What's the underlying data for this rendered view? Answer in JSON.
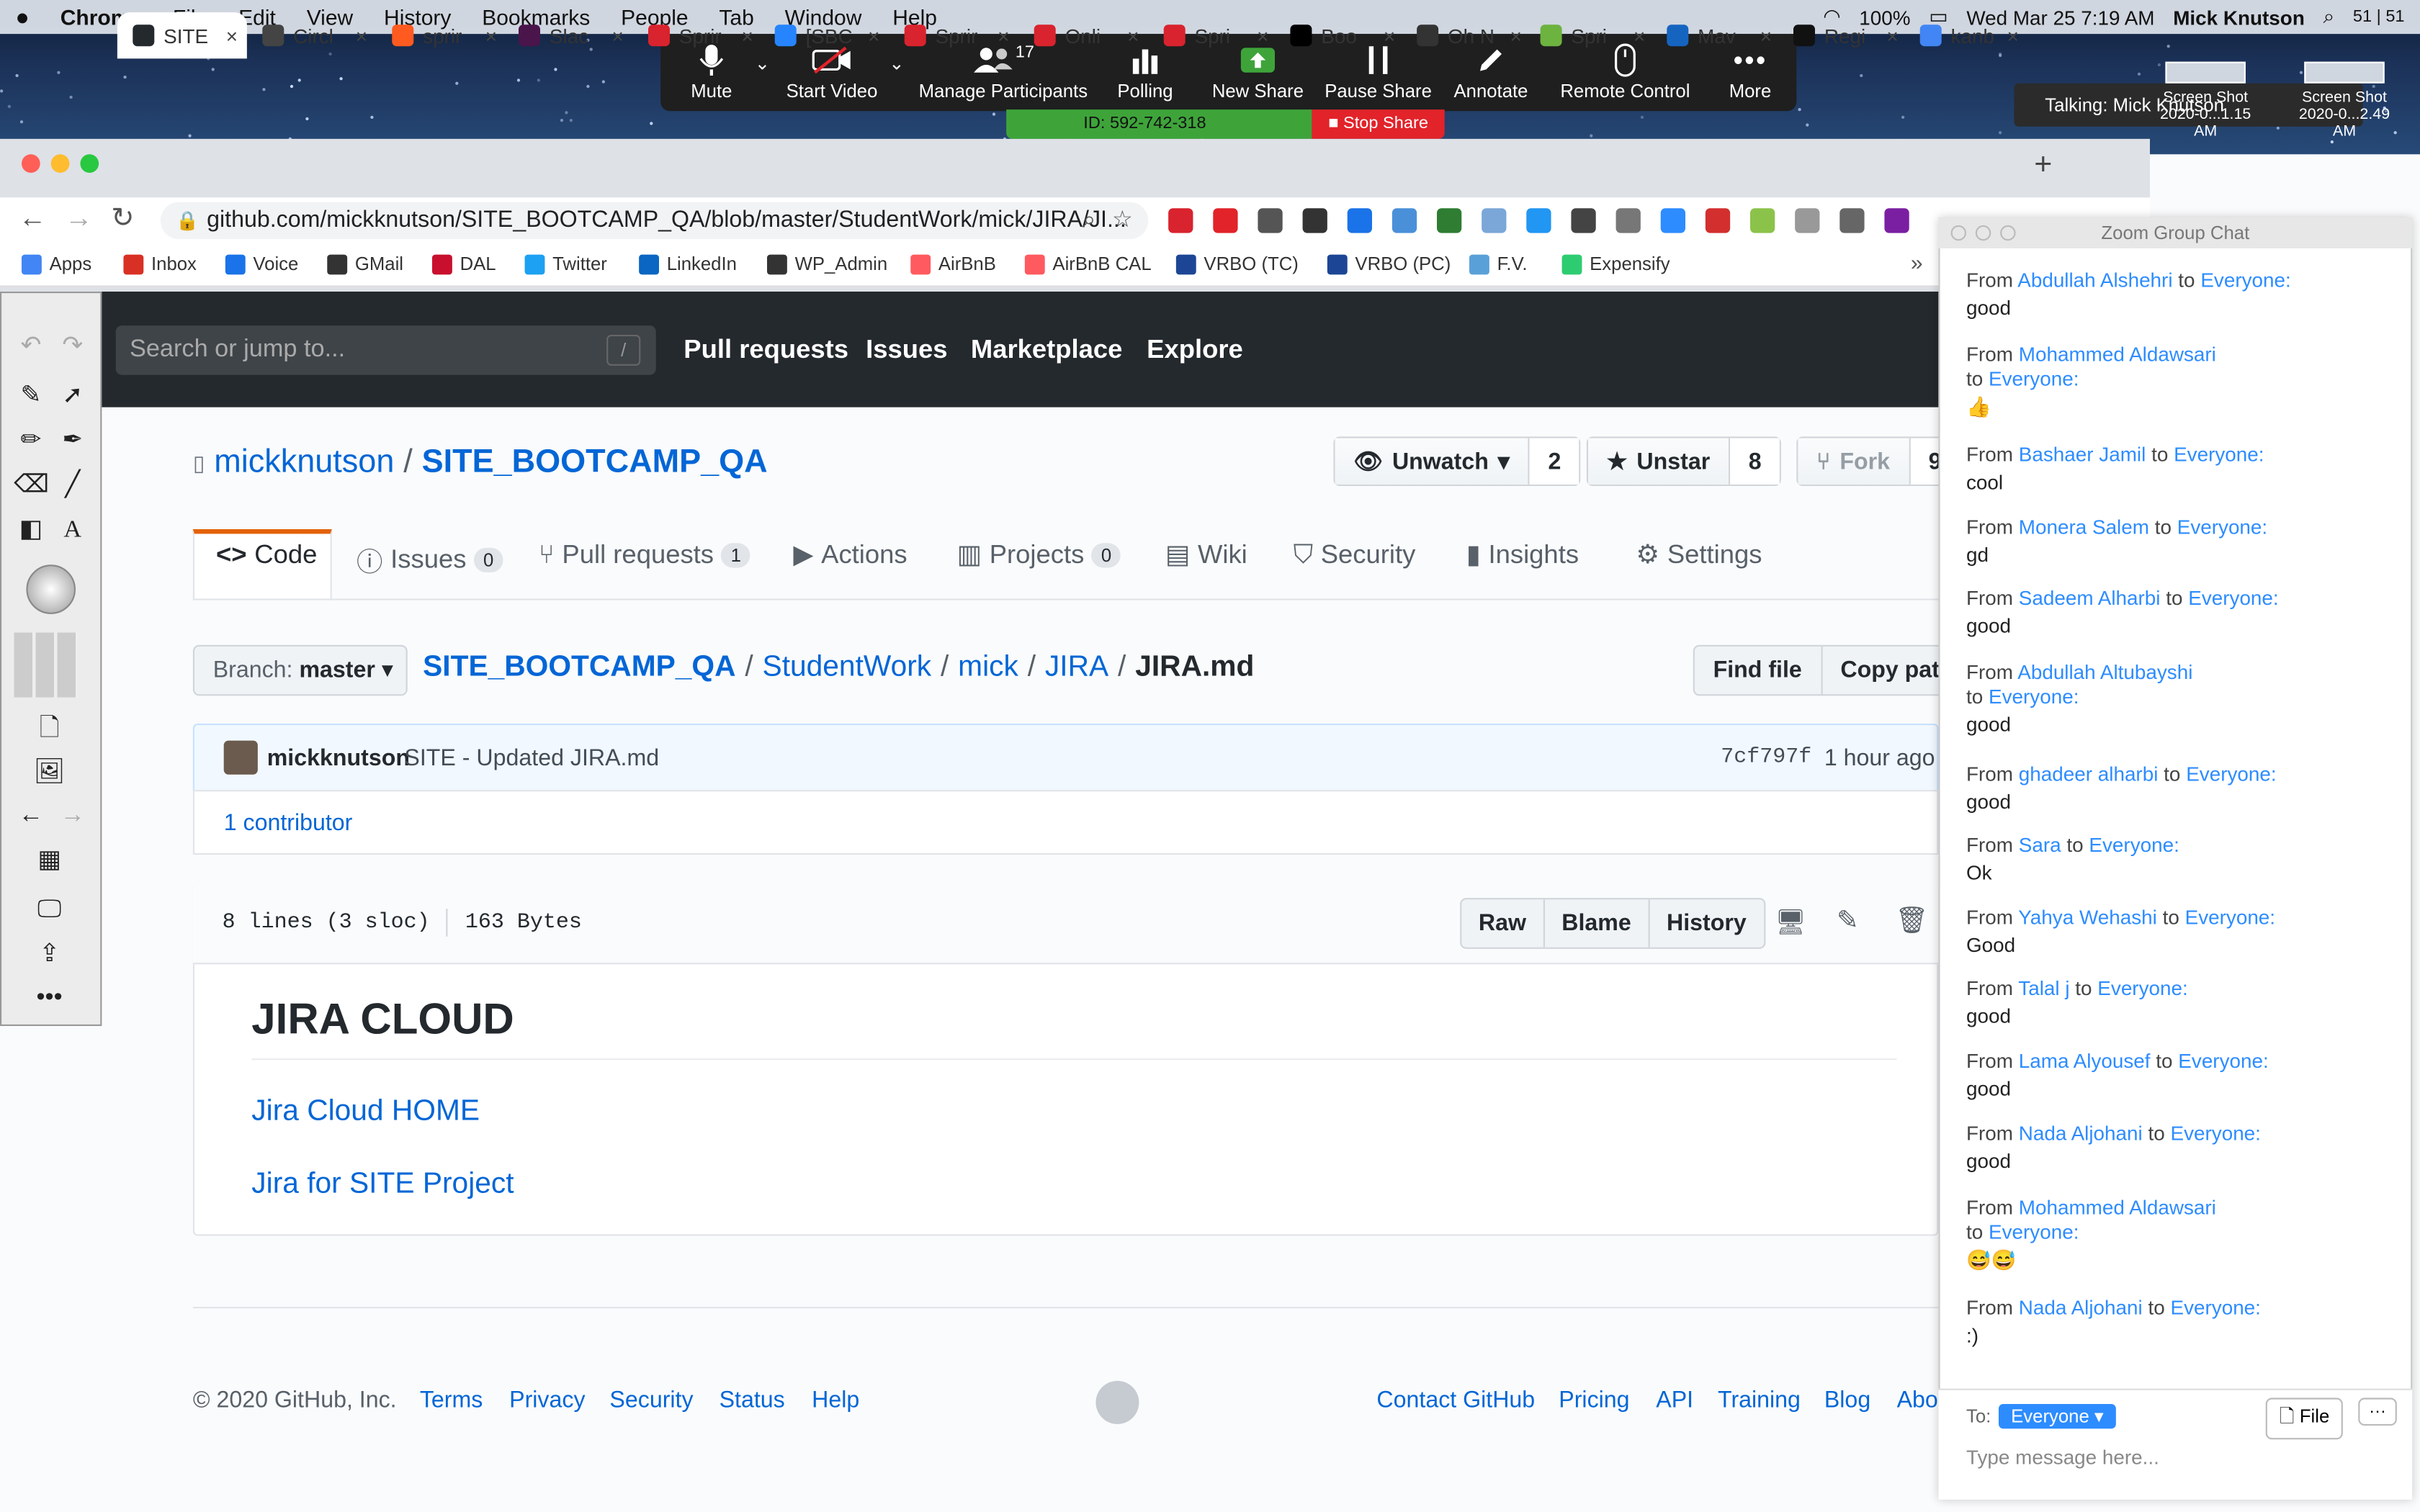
{
  "menubar": {
    "apple_icon": "apple-icon",
    "app": "Chrome",
    "items": [
      "File",
      "Edit",
      "View",
      "History",
      "Bookmarks",
      "People",
      "Tab",
      "Window",
      "Help"
    ],
    "battery": "100%",
    "datetime": "Wed Mar 25  7:19 AM",
    "user": "Mick Knutson",
    "badge": "51 | 51"
  },
  "zoom": {
    "buttons": [
      {
        "label": "Mute",
        "icon": "microphone-icon"
      },
      {
        "label": "Start Video",
        "icon": "video-off-icon"
      },
      {
        "label": "Manage Participants",
        "icon": "participants-icon",
        "count": "17"
      },
      {
        "label": "Polling",
        "icon": "polling-icon"
      },
      {
        "label": "New Share",
        "icon": "share-icon"
      },
      {
        "label": "Pause Share",
        "icon": "pause-icon"
      },
      {
        "label": "Annotate",
        "icon": "pencil-icon"
      },
      {
        "label": "Remote Control",
        "icon": "mouse-icon"
      },
      {
        "label": "More",
        "icon": "more-icon"
      }
    ],
    "meeting_id": "ID: 592-742-318",
    "stop_share": "Stop Share",
    "talking": "Talking: Mick Knutson",
    "screenshots": [
      {
        "line1": "Screen Shot",
        "line2": "2020-0...1.15 AM"
      },
      {
        "line1": "Screen Shot",
        "line2": "2020-0...2.49 AM"
      }
    ]
  },
  "chrome": {
    "tabs": [
      {
        "label": "SITE",
        "color": "#24292e",
        "active": true
      },
      {
        "label": "Circl",
        "color": "#444"
      },
      {
        "label": "sprir",
        "color": "#ff5a1f"
      },
      {
        "label": "Slac",
        "color": "#4a154b"
      },
      {
        "label": "Sprir",
        "color": "#d9232e"
      },
      {
        "label": "[SBC",
        "color": "#2684ff"
      },
      {
        "label": "Sprir",
        "color": "#d9232e"
      },
      {
        "label": "Onli",
        "color": "#d9232e"
      },
      {
        "label": "Spri",
        "color": "#d9232e"
      },
      {
        "label": "Boo",
        "color": "#000"
      },
      {
        "label": "Oh N",
        "color": "#333"
      },
      {
        "label": "Spri",
        "color": "#6db33f"
      },
      {
        "label": "Mav",
        "color": "#1565c0"
      },
      {
        "label": "Regi",
        "color": "#111"
      },
      {
        "label": "kanb",
        "color": "#4285f4"
      }
    ],
    "url": "github.com/mickknutson/SITE_BOOTCAMP_QA/blob/master/StudentWork/mick/JIRA/JI...",
    "bookmarks": [
      {
        "label": "Apps",
        "color": "#4285f4"
      },
      {
        "label": "Inbox",
        "color": "#d93025"
      },
      {
        "label": "Voice",
        "color": "#1a73e8"
      },
      {
        "label": "GMail",
        "color": "#333"
      },
      {
        "label": "DAL",
        "color": "#c8102e"
      },
      {
        "label": "Twitter",
        "color": "#1da1f2"
      },
      {
        "label": "LinkedIn",
        "color": "#0a66c2"
      },
      {
        "label": "WP_Admin",
        "color": "#333"
      },
      {
        "label": "AirBnB",
        "color": "#ff5a5f"
      },
      {
        "label": "AirBnB CAL",
        "color": "#ff5a5f"
      },
      {
        "label": "VRBO (TC)",
        "color": "#1c4695"
      },
      {
        "label": "VRBO (PC)",
        "color": "#1c4695"
      },
      {
        "label": "F.V.",
        "color": "#5aa0d8"
      },
      {
        "label": "Expensify",
        "color": "#2ecc71"
      }
    ]
  },
  "github": {
    "search_placeholder": "Search or jump to...",
    "search_key": "/",
    "nav": [
      "Pull requests",
      "Issues",
      "Marketplace",
      "Explore"
    ],
    "owner": "mickknutson",
    "repo": "SITE_BOOTCAMP_QA",
    "unwatch": "Unwatch",
    "watch_count": "2",
    "unstar": "Unstar",
    "star_count": "8",
    "fork": "Fork",
    "fork_count": "9",
    "tabs": [
      {
        "label": "Code",
        "icon": "code-icon"
      },
      {
        "label": "Issues",
        "icon": "issue-icon",
        "count": "0"
      },
      {
        "label": "Pull requests",
        "icon": "pull-request-icon",
        "count": "1"
      },
      {
        "label": "Actions",
        "icon": "play-icon"
      },
      {
        "label": "Projects",
        "icon": "project-icon",
        "count": "0"
      },
      {
        "label": "Wiki",
        "icon": "book-icon"
      },
      {
        "label": "Security",
        "icon": "shield-icon"
      },
      {
        "label": "Insights",
        "icon": "graph-icon"
      },
      {
        "label": "Settings",
        "icon": "gear-icon"
      }
    ],
    "branch_label": "Branch:",
    "branch": "master",
    "crumbs": [
      "SITE_BOOTCAMP_QA",
      "StudentWork",
      "mick",
      "JIRA"
    ],
    "file": "JIRA.md",
    "find_file": "Find file",
    "copy_path": "Copy path",
    "commit_author": "mickknutson",
    "commit_msg": "SITE - Updated JIRA.md",
    "commit_sha": "7cf797f",
    "commit_time": "1 hour ago",
    "contributors": "1 contributor",
    "lines": "8 lines (3 sloc)",
    "size": "163 Bytes",
    "raw": "Raw",
    "blame": "Blame",
    "history": "History",
    "md_title": "JIRA CLOUD",
    "md_links": [
      "Jira Cloud HOME",
      "Jira for SITE Project"
    ],
    "copyright": "© 2020 GitHub, Inc.",
    "footer_left": [
      "Terms",
      "Privacy",
      "Security",
      "Status",
      "Help"
    ],
    "footer_right": [
      "Contact GitHub",
      "Pricing",
      "API",
      "Training",
      "Blog",
      "Abo"
    ]
  },
  "chat": {
    "title": "Zoom Group Chat",
    "from": "From",
    "to": "to",
    "everyone": "Everyone:",
    "messages": [
      {
        "sender": "Abdullah Alshehri",
        "text": "good"
      },
      {
        "sender": "Mohammed Aldawsari",
        "text": "👍"
      },
      {
        "sender": "Bashaer Jamil",
        "text": "cool"
      },
      {
        "sender": "Monera Salem",
        "text": "gd"
      },
      {
        "sender": "Sadeem Alharbi",
        "text": "good"
      },
      {
        "sender": "Abdullah Altubayshi",
        "text": "good"
      },
      {
        "sender": "ghadeer alharbi",
        "text": "good"
      },
      {
        "sender": "Sara",
        "text": "Ok"
      },
      {
        "sender": "Yahya Wehashi",
        "text": "Good"
      },
      {
        "sender": "Talal j",
        "text": "good"
      },
      {
        "sender": "Lama Alyousef",
        "text": "good"
      },
      {
        "sender": "Nada Aljohani",
        "text": "good"
      },
      {
        "sender": "Mohammed Aldawsari",
        "text": "😅😅"
      },
      {
        "sender": "Nada Aljohani",
        "text": ":)"
      }
    ],
    "to_label": "To:",
    "recipient": "Everyone",
    "file_btn": "File",
    "more_btn": "···",
    "input_placeholder": "Type message here..."
  },
  "colors": {
    "github_dark": "#24292e",
    "link": "#0366d6",
    "zoom_blue": "#2d8cff",
    "stop_red": "#e2232a",
    "share_green": "#3ea43a"
  }
}
